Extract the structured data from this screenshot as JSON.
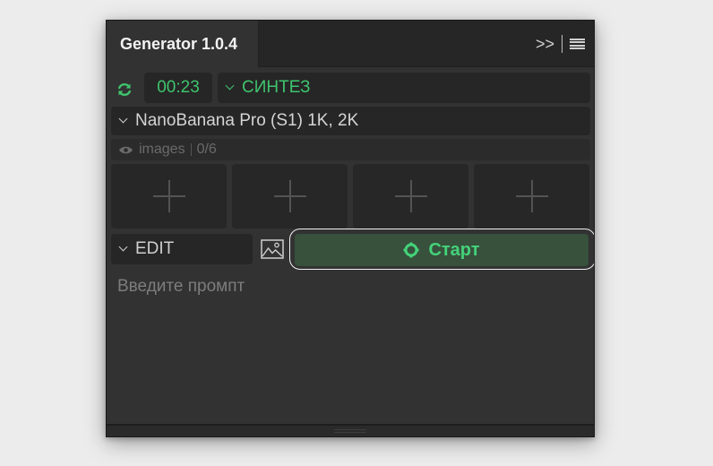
{
  "panel": {
    "title": "Generator 1.0.4",
    "header_icons": [
      "expand-icon",
      "menu-icon"
    ],
    "expand_glyph": ">>"
  },
  "controls": {
    "timer": "00:23",
    "mode": "СИНТЕЗ",
    "model": "NanoBanana Pro (S1) 1K, 2K",
    "images_label": "images",
    "images_count": "0/6",
    "image_slots": 4,
    "edit_mode": "EDIT",
    "start_label": "Старт",
    "prompt_placeholder": "Введите промпт",
    "prompt_value": ""
  },
  "colors": {
    "accent_green": "#3ec46d",
    "start_bg": "#37513c",
    "panel_bg": "#323232",
    "page_bg": "#ececec"
  }
}
